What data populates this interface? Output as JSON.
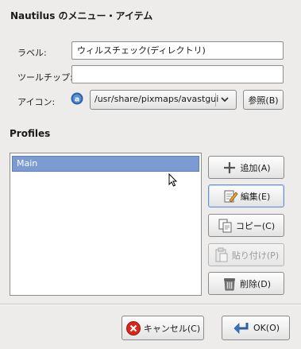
{
  "dialog": {
    "title": "Nautilus のメニュー・アイテム"
  },
  "form": {
    "label_label": "ラベル:",
    "label_value": "ウィルスチェック(ディレクトリ)",
    "tooltip_label": "ツールチップ:",
    "tooltip_value": "",
    "icon_label": "アイコン:",
    "icon_path": "/usr/share/pixmaps/avastgui",
    "browse_label": "参照(B)"
  },
  "profiles": {
    "heading": "Profiles",
    "items": [
      {
        "label": "Main",
        "selected": true
      }
    ]
  },
  "side_buttons": {
    "add": "追加(A)",
    "edit": "編集(E)",
    "copy": "コピー(C)",
    "paste": "貼り付け(P)",
    "delete": "削除(D)"
  },
  "footer": {
    "cancel": "キャンセル(C)",
    "ok": "OK(O)"
  },
  "colors": {
    "selection": "#7b9bd2",
    "cancel_icon": "#d7261b",
    "ok_icon": "#3a73c4"
  }
}
